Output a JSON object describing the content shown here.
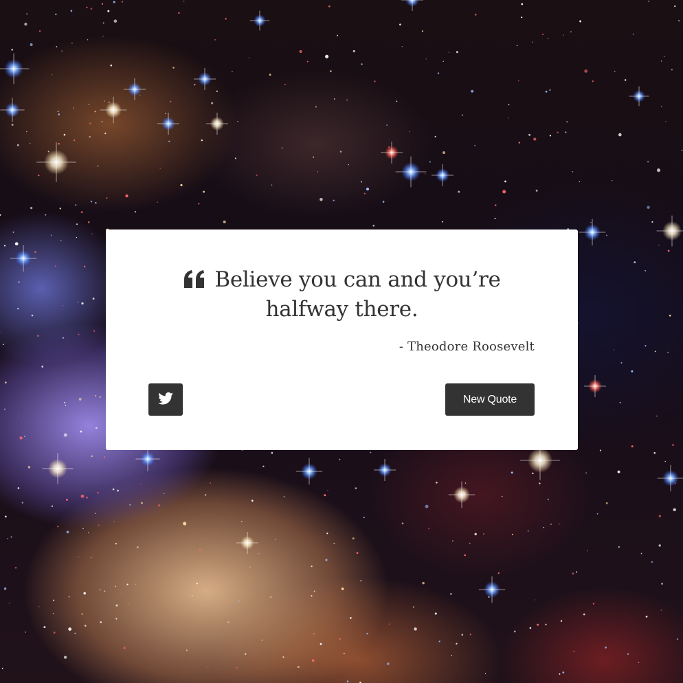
{
  "background": {
    "description_icon": "space-nebula-background"
  },
  "quote_card": {
    "quote_text": "Believe you can and you’re halfway there.",
    "author": "- Theodore Roosevelt",
    "quote_icon": "quote-left-icon",
    "tweet_icon": "twitter-icon",
    "new_quote_label": "New Quote"
  },
  "colors": {
    "card_background": "#ffffff",
    "text": "#333333",
    "button_background": "#333333",
    "button_text": "#ffffff"
  }
}
